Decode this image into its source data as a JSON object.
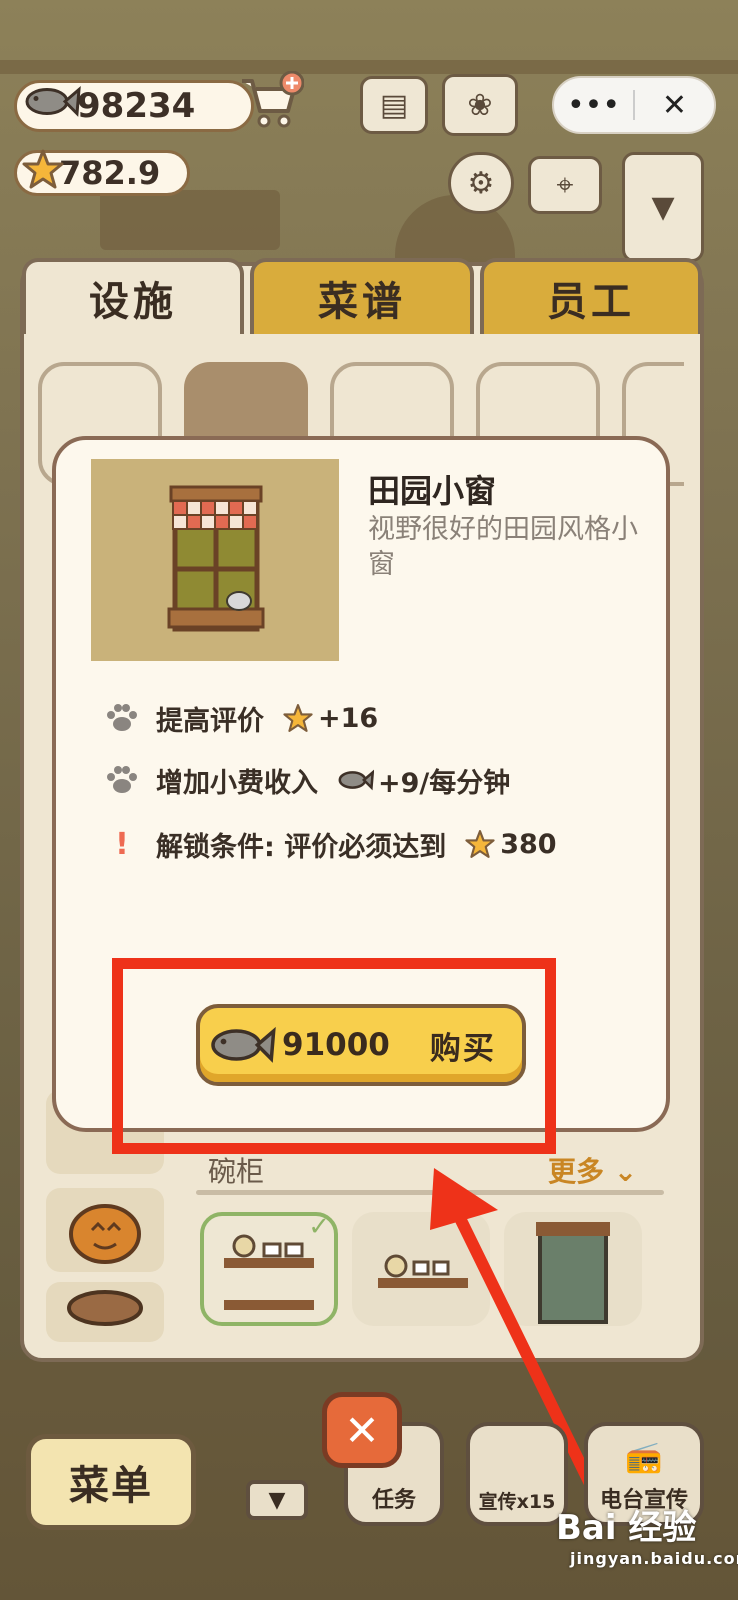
{
  "hud": {
    "fish_amount": "98234",
    "rating": "782.9",
    "icons": [
      "fish-icon",
      "star-icon",
      "cart-plus-icon",
      "newspaper-icon",
      "album-icon",
      "settings-gear-icon",
      "map-icon",
      "ranking-icon"
    ]
  },
  "capsule": {
    "more_glyph": "•••",
    "close_glyph": "✕"
  },
  "tabs": [
    {
      "label": "设施",
      "active": true
    },
    {
      "label": "菜谱",
      "active": false
    },
    {
      "label": "员工",
      "active": false
    }
  ],
  "category_icons": [
    "tools-icon",
    "mixing-bowl-icon",
    "watering-can-icon",
    "locked-icon",
    "locked-icon-2"
  ],
  "section": {
    "title": "碗柜",
    "more": "更多"
  },
  "dialog": {
    "name": "田园小窗",
    "description": "视野很好的田园风格小窗",
    "stats": [
      {
        "icon": "paw-icon",
        "label": "提高评价",
        "value_icon": "star-icon",
        "value": "+16"
      },
      {
        "icon": "paw-icon",
        "label": "增加小费收入",
        "value_icon": "fish-icon",
        "value": "+9/每分钟"
      },
      {
        "icon": "exclamation-icon",
        "label": "解锁条件: 评价必须达到",
        "value_icon": "star-icon",
        "value": "380"
      }
    ],
    "buy": {
      "price": "91000",
      "label": "购买"
    }
  },
  "bottom": {
    "menu_label": "菜单",
    "tasks_label": "任务",
    "promo_label": "宣传x15",
    "radio_label": "电台宣传"
  },
  "watermark": {
    "brand": "Bai 经验",
    "url": "jingyan.baidu.com"
  },
  "colors": {
    "accent_yellow": "#f8cf4c",
    "highlight_red": "#ee3219",
    "panel_bg": "#efe6d2",
    "tab_inactive": "#d9ac3c"
  }
}
